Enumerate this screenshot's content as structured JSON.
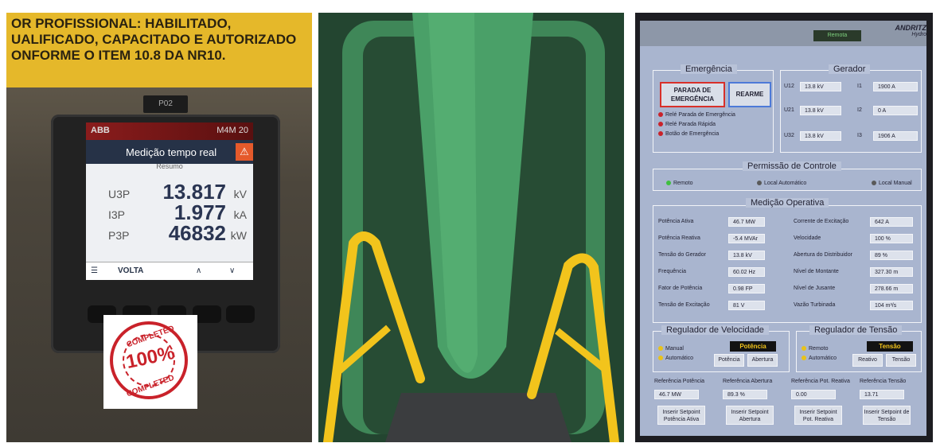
{
  "meter_photo": {
    "warning_lines": [
      "OR       PROFISSIONAL:        HABILITADO,",
      "UALIFICADO, CAPACITADO E AUTORIZADO",
      "ONFORME O ITEM 10.8 DA NR10."
    ],
    "tag": "P02",
    "brand": "ABB",
    "model": "M4M 20",
    "screen_title": "Medição tempo real",
    "screen_subtitle": "Resumo",
    "readings": [
      {
        "label": "U3P",
        "value": "13.817",
        "unit": "kV"
      },
      {
        "label": "I3P",
        "value": "1.977",
        "unit": "kA"
      },
      {
        "label": "P3P",
        "value": "46832",
        "unit": "kW"
      }
    ],
    "footer_button": "VOLTA",
    "stamp_top": "COMPLETED",
    "stamp_pct": "100%",
    "stamp_bottom": "COMPLETED"
  },
  "hmi": {
    "remote_label": "Remota",
    "logo": "ANDRITZ",
    "logo_sub": "Hydro",
    "emergencia": {
      "title": "Emergência",
      "stop_button": "PARADA DE EMERGÊNCIA",
      "reset_button": "REARME",
      "items": [
        "Relé Parada de Emergência",
        "Relé Parada Rápida",
        "Botão de Emergência"
      ]
    },
    "gerador": {
      "title": "Gerador",
      "rows": [
        {
          "vlabel": "U12",
          "vvalue": "13.8  kV",
          "ilabel": "I1",
          "ivalue": "1900  A"
        },
        {
          "vlabel": "U21",
          "vvalue": "13.8  kV",
          "ilabel": "I2",
          "ivalue": "0  A"
        },
        {
          "vlabel": "U32",
          "vvalue": "13.8  kV",
          "ilabel": "I3",
          "ivalue": "1906  A"
        }
      ]
    },
    "permissao": {
      "title": "Permissão de Controle",
      "options": [
        "Remoto",
        "Local Automático",
        "Local Manual"
      ]
    },
    "medicao": {
      "title": "Medição Operativa",
      "left": [
        {
          "label": "Potência Ativa",
          "value": "46.7  MW"
        },
        {
          "label": "Potência Reativa",
          "value": "-5.4  MVAr"
        },
        {
          "label": "Tensão do Gerador",
          "value": "13.8  kV"
        },
        {
          "label": "Frequência",
          "value": "60.02  Hz"
        },
        {
          "label": "Fator de Potência",
          "value": "0.98  FP"
        },
        {
          "label": "Tensão de Excitação",
          "value": "81  V"
        }
      ],
      "right": [
        {
          "label": "Corrente de Excitação",
          "value": "642  A"
        },
        {
          "label": "Velocidade",
          "value": "100  %"
        },
        {
          "label": "Abertura do Distribuidor",
          "value": "89  %"
        },
        {
          "label": "Nível de Montante",
          "value": "327.30  m"
        },
        {
          "label": "Nível de Jusante",
          "value": "278.66  m"
        },
        {
          "label": "Vazão Turbinada",
          "value": "104  m³/s"
        }
      ]
    },
    "reg_vel": {
      "title": "Regulador de Velocidade",
      "mode_badge": "Potência",
      "options": [
        "Manual",
        "Automático"
      ],
      "btn1": "Potência",
      "btn2": "Abertura"
    },
    "reg_ten": {
      "title": "Regulador de Tensão",
      "mode_badge": "Tensão",
      "options": [
        "Remoto",
        "Automático"
      ],
      "btn1": "Reativo",
      "btn2": "Tensão"
    },
    "refs": [
      {
        "label": "Referência Potência",
        "value": "46.7  MW",
        "button": "Inserir Setpoint Potência Ativa"
      },
      {
        "label": "Referência Abertura",
        "value": "89.3  %",
        "button": "Inserir Setpoint Abertura"
      },
      {
        "label": "Referência Pot. Reativa",
        "value": "0.00",
        "button": "Inserir Setpoint Pot. Reativa"
      },
      {
        "label": "Referência Tensão",
        "value": "13.71",
        "button": "Inserir Setpoint de Tensão"
      }
    ]
  },
  "colors": {
    "red": "#c9222a",
    "yellow": "#f2c41c",
    "green": "#4f9a66",
    "hmi_bg": "#a9b5cf"
  }
}
